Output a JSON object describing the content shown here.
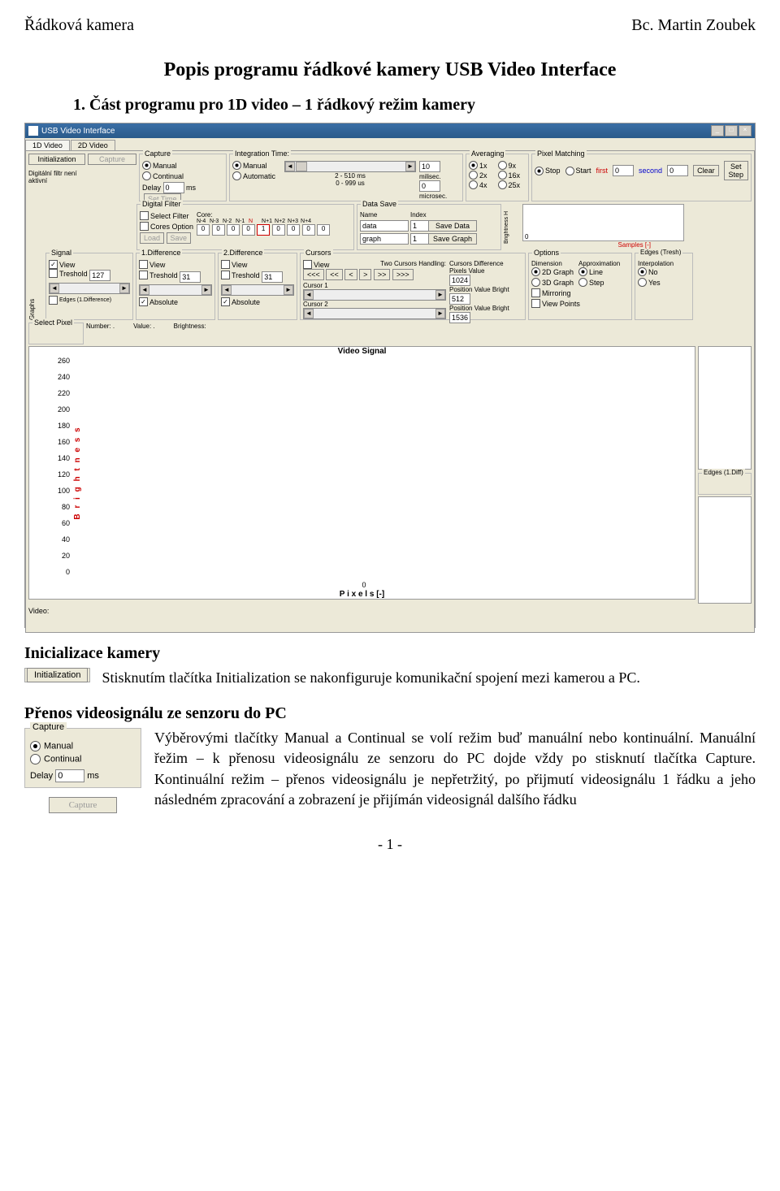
{
  "page": {
    "header_left": "Řádková kamera",
    "header_right": "Bc. Martin Zoubek",
    "title": "Popis programu řádkové kamery USB Video Interface",
    "subtitle": "1. Část programu pro 1D video – 1 řádkový režim kamery",
    "footer": "- 1 -"
  },
  "app": {
    "window_title": "USB Video Interface",
    "tabs": [
      "1D Video",
      "2D Video"
    ],
    "initialization_btn": "Initialization",
    "capture_btn": "Capture",
    "filter_status": "Digitální filtr není aktivní",
    "capture_grp": {
      "title": "Capture",
      "manual": "Manual",
      "continual": "Continual",
      "delay_lbl": "Delay",
      "delay_val": "0",
      "delay_unit": "ms",
      "set_time": "Set Time"
    },
    "integration_grp": {
      "title": "Integration Time:",
      "manual": "Manual",
      "automatic": "Automatic",
      "range_ms": "2 - 510 ms",
      "val_ms": "10",
      "unit_ms": "milisec.",
      "range_us": "0 - 999 us",
      "val_us": "0",
      "unit_us": "microsec."
    },
    "averaging_grp": {
      "title": "Averaging",
      "opts": [
        "1x",
        "9x",
        "2x",
        "16x",
        "4x",
        "25x"
      ]
    },
    "pixel_matching_grp": {
      "title": "Pixel Matching",
      "stop": "Stop",
      "start": "Start",
      "first_lbl": "first",
      "first_val": "0",
      "second_lbl": "second",
      "second_val": "0",
      "clear": "Clear",
      "set_step": "Set Step"
    },
    "digital_filter_grp": {
      "title": "Digital Filter",
      "select_filter": "Select Filter",
      "cores_option": "Cores Option",
      "load": "Load",
      "save": "Save",
      "core_title": "Core:",
      "core_labels": [
        "N-4",
        "N-3",
        "N-2",
        "N-1",
        "N",
        "N+1",
        "N+2",
        "N+3",
        "N+4"
      ],
      "core_vals": [
        "0",
        "0",
        "0",
        "0",
        "1",
        "0",
        "0",
        "0",
        "0"
      ]
    },
    "data_save_grp": {
      "title": "Data Save",
      "name_lbl": "Name",
      "index_lbl": "Index",
      "name1": "data",
      "idx1": "1",
      "btn1": "Save Data",
      "name2": "graph",
      "idx2": "1",
      "btn2": "Save Graph"
    },
    "brightness_axis": "Brightness H",
    "zero": "0",
    "samples_lbl": "Samples [-]",
    "graphs_title": "Graphs",
    "signal_grp": {
      "title": "Signal",
      "view": "View",
      "treshold_lbl": "Treshold",
      "treshold_val": "127",
      "edges": "Edges (1.Difference)"
    },
    "diff1_grp": {
      "title": "1.Difference",
      "view": "View",
      "treshold_lbl": "Treshold",
      "treshold_val": "31",
      "absolute": "Absolute"
    },
    "diff2_grp": {
      "title": "2.Difference",
      "view": "View",
      "treshold_lbl": "Treshold",
      "treshold_val": "31",
      "absolute": "Absolute"
    },
    "cursors_grp": {
      "title": "Cursors",
      "two_handling": "Two Cursors Handling:",
      "view": "View",
      "nav": [
        "<<<",
        "<<",
        "<",
        ">",
        ">>",
        ">>>"
      ],
      "cursor1": "Cursor 1",
      "cursor2": "Cursor 2",
      "cursors_diff": "Cursors Difference",
      "pixels": "Pixels",
      "value": "Value",
      "position": "Position",
      "bright": "Bright",
      "diff_val": "1024",
      "c1_pos": "512",
      "c2_pos": "1536"
    },
    "options_grp": {
      "title": "Options",
      "dimension": "Dimension",
      "d2": "2D Graph",
      "d3": "3D Graph",
      "approx": "Approximation",
      "line": "Line",
      "step": "Step",
      "mirroring": "Mirroring",
      "view_points": "View Points"
    },
    "edges_tresh_grp": {
      "title": "Edges (Tresh)",
      "interpolation": "Interpolation",
      "no": "No",
      "yes": "Yes"
    },
    "edges_diff_grp": {
      "title": "Edges (1.Diff)"
    },
    "select_pixel": {
      "title": "Select Pixel",
      "number": "Number: .",
      "value": "Value: .",
      "brightness": "Brightness:"
    },
    "chart": {
      "title": "Video Signal",
      "xlabel": "P i x e l s [-]",
      "ylabel": "B r i g h t n e s s",
      "yticks": [
        "260",
        "240",
        "220",
        "200",
        "180",
        "160",
        "140",
        "120",
        "100",
        "80",
        "60",
        "40",
        "20",
        "0"
      ],
      "xzero": "0"
    },
    "status_bar": "Video:"
  },
  "chart_data": {
    "type": "line",
    "title": "Video Signal",
    "xlabel": "Pixels [-]",
    "ylabel": "Brightness",
    "ylim": [
      0,
      260
    ],
    "series": [],
    "note": "empty plot area with y-axis ticks from 0 to 260 in steps of 20"
  },
  "sections": {
    "init": {
      "heading": "Inicializace kamery",
      "button_img_label": "Initialization",
      "text": "Stisknutím tlačítka Initialization se nakonfiguruje komunikační spojení mezi kamerou a PC."
    },
    "transfer": {
      "heading": "Přenos videosignálu ze senzoru do PC",
      "capture_panel": {
        "title": "Capture",
        "manual": "Manual",
        "continual": "Continual",
        "delay_lbl": "Delay",
        "delay_val": "0",
        "delay_unit": "ms",
        "capture_btn": "Capture"
      },
      "text": "Výběrovými tlačítky Manual a Continual se volí režim buď manuální nebo kontinuální. Manuální řežim – k přenosu videosignálu ze senzoru do PC dojde vždy po stisknutí tlačítka Capture. Kontinuální režim – přenos videosignálu je nepřetržitý, po přijmutí videosignálu 1 řádku a jeho následném zpracování a zobrazení je přijímán videosignál dalšího řádku"
    }
  }
}
